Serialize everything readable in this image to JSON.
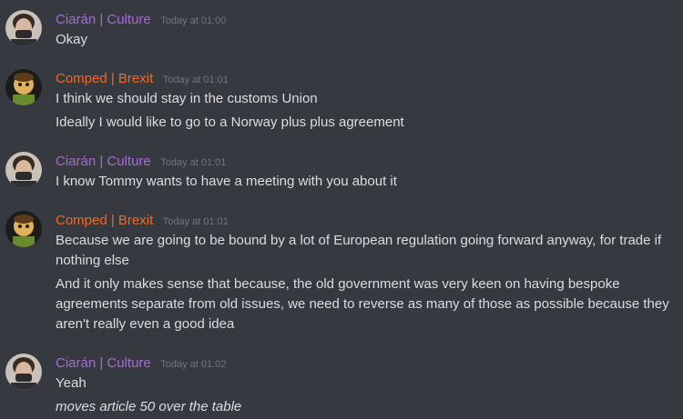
{
  "users": {
    "ciaran": {
      "name": "Ciarán | Culture",
      "color": "#a66bd6",
      "avatar": "masked-person-avatar"
    },
    "comped": {
      "name": "Comped | Brexit",
      "color": "#f06a24",
      "avatar": "cartoon-character-avatar"
    }
  },
  "messages": [
    {
      "user": "Ciarán | Culture",
      "time": "Today at 01:00",
      "lines": [
        "Okay"
      ]
    },
    {
      "user": "Comped | Brexit",
      "time": "Today at 01:01",
      "lines": [
        "I think we should stay in the customs Union",
        "Ideally I would like to go to a Norway plus plus agreement"
      ]
    },
    {
      "user": "Ciarán | Culture",
      "time": "Today at 01:01",
      "lines": [
        "I know Tommy wants to have a meeting with you about it"
      ]
    },
    {
      "user": "Comped | Brexit",
      "time": "Today at 01:01",
      "lines": [
        "Because we are going to be bound by a lot of European regulation going forward anyway, for trade if nothing else",
        "And it only makes sense that because, the old government was very keen on having bespoke agreements separate from old issues, we need to reverse as many of those as possible because they aren't really even a good idea"
      ]
    },
    {
      "user": "Ciarán | Culture",
      "time": "Today at 01:02",
      "lines": [
        "Yeah",
        "moves article 50 over the table"
      ]
    }
  ],
  "colors": {
    "background": "#36393f",
    "text": "#dcddde",
    "timestamp": "#72767d"
  }
}
